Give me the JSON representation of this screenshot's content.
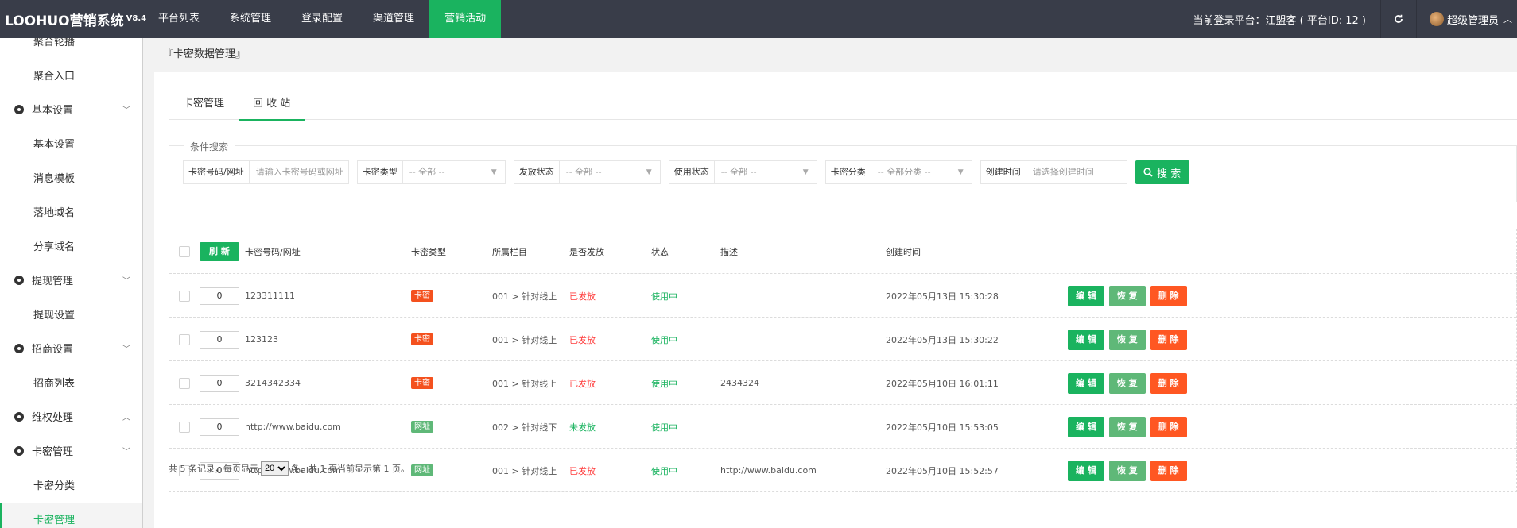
{
  "app": {
    "name": "LOOHUO营销系统",
    "version": "V8.4"
  },
  "topnav": [
    {
      "label": "平台列表",
      "active": false
    },
    {
      "label": "系统管理",
      "active": false
    },
    {
      "label": "登录配置",
      "active": false
    },
    {
      "label": "渠道管理",
      "active": false
    },
    {
      "label": "营销活动",
      "active": true
    }
  ],
  "header": {
    "platform": "当前登录平台：江盟客 ( 平台ID: 12 )",
    "admin": "超级管理员"
  },
  "sidebar": [
    {
      "label": "聚合轮播",
      "type": "item"
    },
    {
      "label": "聚合入口",
      "type": "item"
    },
    {
      "label": "基本设置",
      "type": "group",
      "chevron": "down"
    },
    {
      "label": "基本设置",
      "type": "item"
    },
    {
      "label": "消息模板",
      "type": "item"
    },
    {
      "label": "落地域名",
      "type": "item"
    },
    {
      "label": "分享域名",
      "type": "item"
    },
    {
      "label": "提现管理",
      "type": "group",
      "chevron": "down"
    },
    {
      "label": "提现设置",
      "type": "item"
    },
    {
      "label": "招商设置",
      "type": "group",
      "chevron": "down"
    },
    {
      "label": "招商列表",
      "type": "item"
    },
    {
      "label": "维权处理",
      "type": "group",
      "chevron": "up"
    },
    {
      "label": "卡密管理",
      "type": "group",
      "chevron": "down"
    },
    {
      "label": "卡密分类",
      "type": "item"
    },
    {
      "label": "卡密管理",
      "type": "item",
      "selected": true
    }
  ],
  "breadcrumb": "『卡密数据管理』",
  "tabs": [
    {
      "label": "卡密管理",
      "active": false
    },
    {
      "label": "回 收 站",
      "active": true
    }
  ],
  "search": {
    "legend": "条件搜索",
    "fields": [
      {
        "label": "卡密号码/网址",
        "placeholder": "请输入卡密号码或网址",
        "dropdown": false,
        "width": 126
      },
      {
        "label": "卡密类型",
        "placeholder": "-- 全部 --",
        "dropdown": true,
        "width": 130
      },
      {
        "label": "发放状态",
        "placeholder": "-- 全部 --",
        "dropdown": true,
        "width": 128
      },
      {
        "label": "使用状态",
        "placeholder": "-- 全部 --",
        "dropdown": true,
        "width": 130
      },
      {
        "label": "卡密分类",
        "placeholder": "-- 全部分类 --",
        "dropdown": true,
        "width": 128
      },
      {
        "label": "创建时间",
        "placeholder": "请选择创建时间",
        "dropdown": false,
        "width": 128
      }
    ],
    "button": "搜 索"
  },
  "table": {
    "refresh_label": "刷 新",
    "columns": [
      "卡密号码/网址",
      "卡密类型",
      "所属栏目",
      "是否发放",
      "状态",
      "描述",
      "创建时间"
    ],
    "rows": [
      {
        "sort": "0",
        "code": "123311111",
        "type": "卡密",
        "type_color": "red",
        "column": "001 > 针对线上",
        "issued": "已发放",
        "issued_color": "red",
        "status": "使用中",
        "desc": "",
        "created": "2022年05月13日 15:30:28"
      },
      {
        "sort": "0",
        "code": "123123",
        "type": "卡密",
        "type_color": "red",
        "column": "001 > 针对线上",
        "issued": "已发放",
        "issued_color": "red",
        "status": "使用中",
        "desc": "",
        "created": "2022年05月13日 15:30:22"
      },
      {
        "sort": "0",
        "code": "3214342334",
        "type": "卡密",
        "type_color": "red",
        "column": "001 > 针对线上",
        "issued": "已发放",
        "issued_color": "red",
        "status": "使用中",
        "desc": "2434324",
        "created": "2022年05月10日 16:01:11"
      },
      {
        "sort": "0",
        "code": "http://www.baidu.com",
        "type": "网址",
        "type_color": "green",
        "column": "002 > 针对线下",
        "issued": "未发放",
        "issued_color": "green",
        "status": "使用中",
        "desc": "",
        "created": "2022年05月10日 15:53:05"
      },
      {
        "sort": "0",
        "code": "http://www.baidu.com",
        "type": "网址",
        "type_color": "green",
        "column": "001 > 针对线上",
        "issued": "已发放",
        "issued_color": "red",
        "status": "使用中",
        "desc": "http://www.baidu.com",
        "created": "2022年05月10日 15:52:57"
      }
    ],
    "actions": {
      "edit": "编 辑",
      "restore": "恢 复",
      "delete": "删 除"
    }
  },
  "pager": {
    "prefix": "共 5 条记录，每页显示",
    "page_size": "20",
    "suffix": "条，共 1 页当前显示第 1 页。"
  }
}
